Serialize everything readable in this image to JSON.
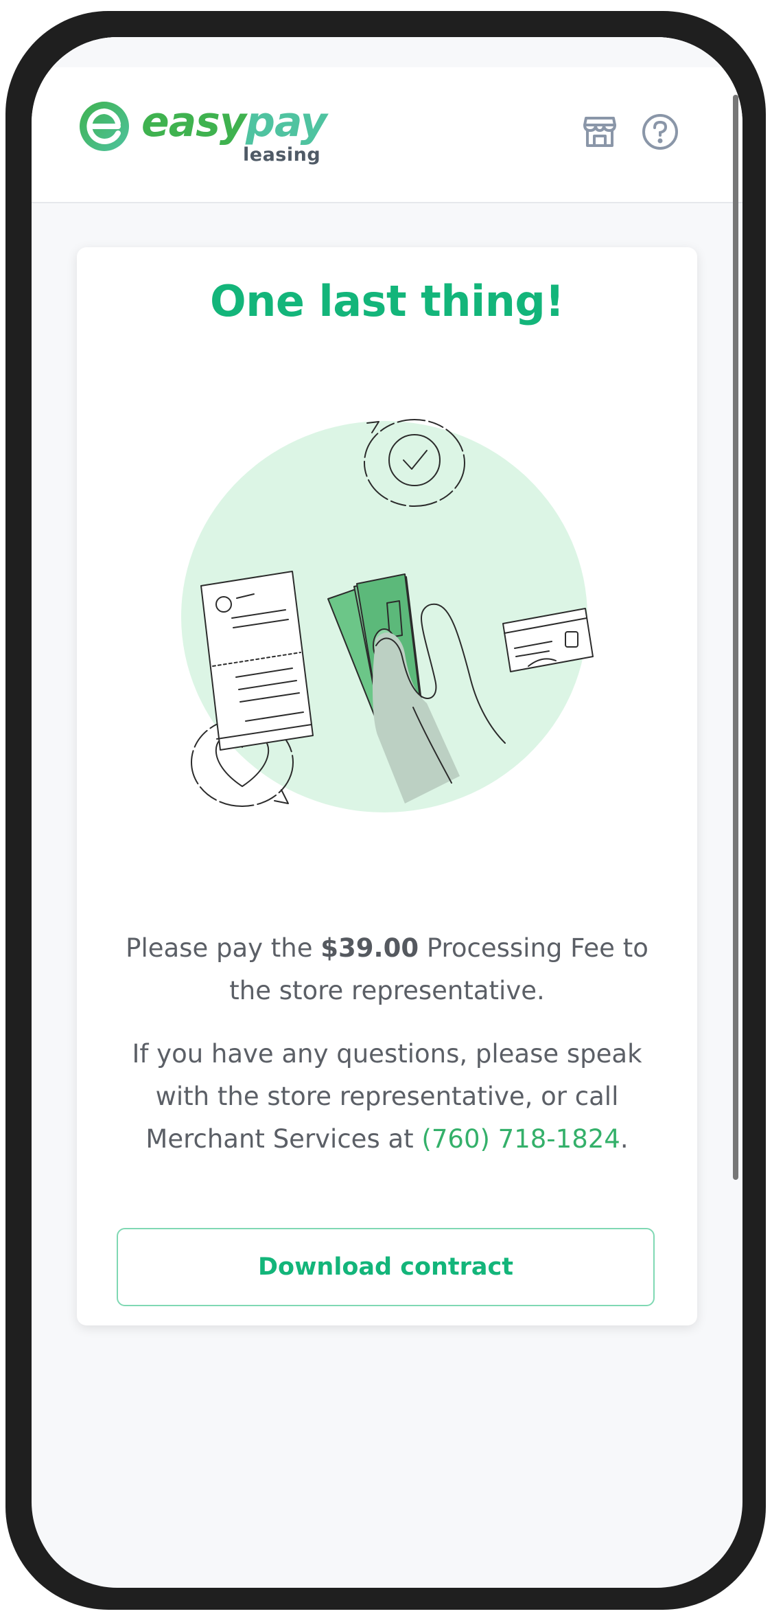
{
  "brand": {
    "word_part1": "easy",
    "word_part2": "pay",
    "sub": "leasing",
    "colors": {
      "primary": "#3fb24f",
      "secondary": "#4fc3a0",
      "accent": "#13b57a"
    }
  },
  "header": {
    "icons": [
      "store-icon",
      "help-icon"
    ]
  },
  "card": {
    "title": "One last thing!",
    "illustration": "hand-with-cash-illustration",
    "message1": {
      "before": "Please pay the ",
      "amount": "$39.00",
      "after": " Processing Fee to the store representative."
    },
    "message2": {
      "before": "If you have any questions, please speak with the store representative, or call Merchant Services at ",
      "phone": "(760) 718-1824",
      "after": "."
    },
    "download_label": "Download contract"
  }
}
